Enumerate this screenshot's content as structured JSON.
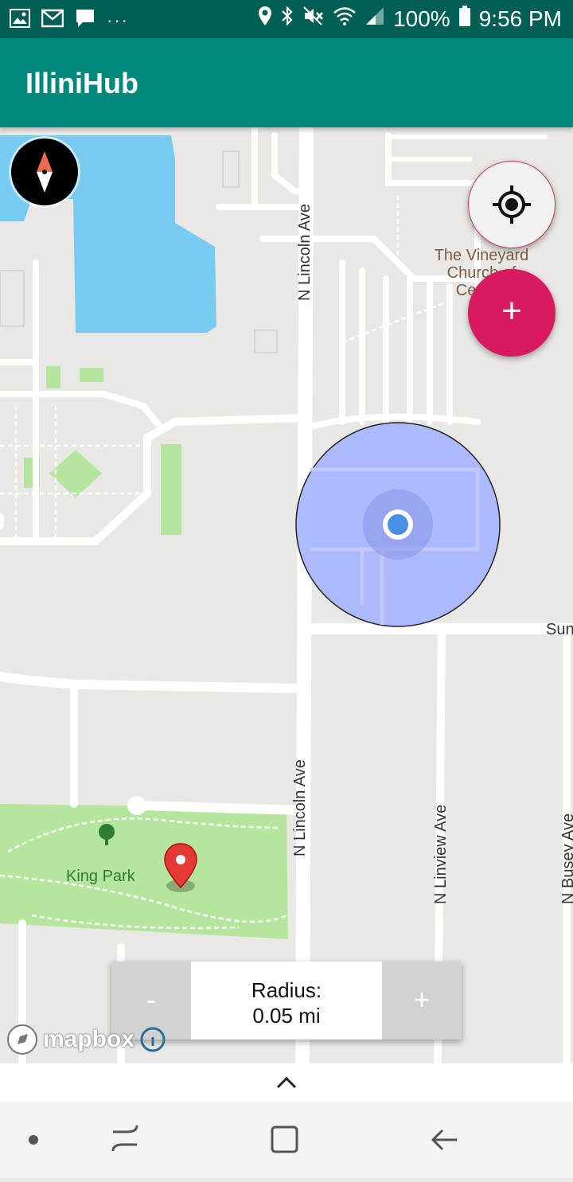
{
  "status_bar": {
    "battery": "100%",
    "time": "9:56 PM",
    "more": "···",
    "icons": [
      "gallery-icon",
      "gmail-icon",
      "message-icon",
      "location-icon",
      "bluetooth-icon",
      "mute-icon",
      "wifi-icon",
      "signal-icon",
      "battery-icon"
    ]
  },
  "app_bar": {
    "title": "IlliniHub"
  },
  "map": {
    "labels": {
      "poi_church": "The Vineyard Church of Central",
      "park": "King Park",
      "street_lincoln_top": "N Lincoln Ave",
      "street_lincoln_bottom": "N Lincoln Ave",
      "street_linview": "N Linview Ave",
      "street_busey": "N Busey Ave",
      "street_sunset": "Sunset"
    },
    "attribution": "mapbox",
    "colors": {
      "water": "#77cbf0",
      "park": "#b6e59e",
      "accuracy_circle": "#a6b4ff",
      "user_dot": "#4a90e2",
      "marker": "#e53935"
    }
  },
  "buttons": {
    "add": "+",
    "locate_icon": "crosshair-icon",
    "compass_icon": "compass-icon"
  },
  "radius_control": {
    "minus": "-",
    "plus": "+",
    "label": "Radius:",
    "value": "0.05 mi"
  },
  "bottom_sheet": {
    "handle_icon": "chevron-up-icon"
  },
  "nav_bar": {
    "icons": [
      "dot-icon",
      "recents-icon",
      "home-icon",
      "back-icon"
    ]
  }
}
